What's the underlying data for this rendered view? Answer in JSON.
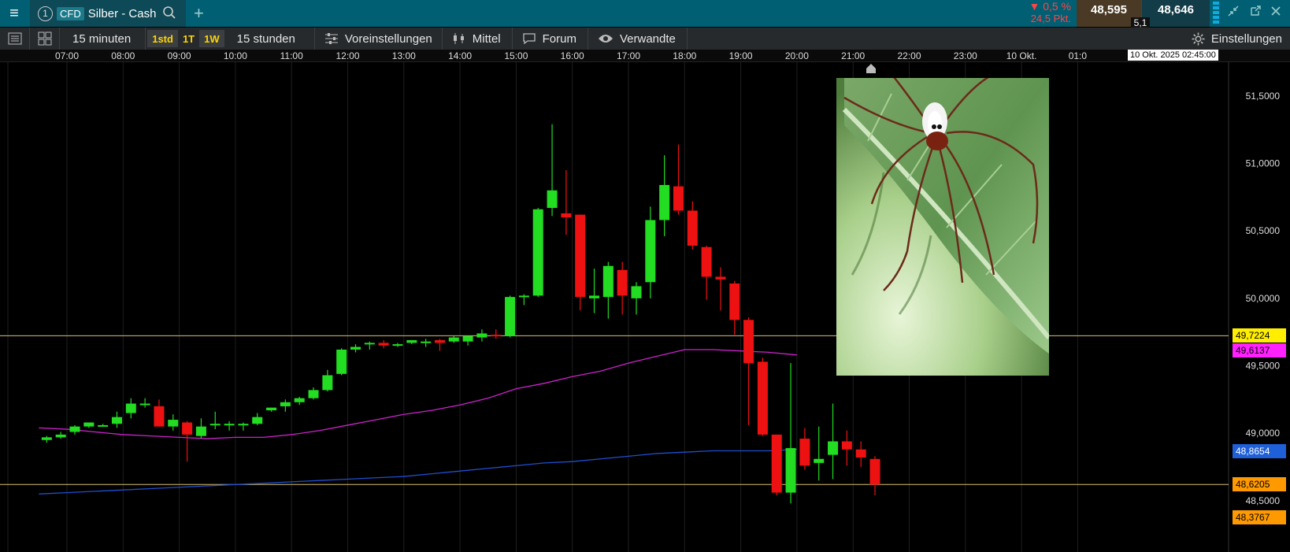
{
  "topbar": {
    "menu_icon": "menu-icon",
    "tab": {
      "number": "1",
      "badge": "CFD",
      "title": "Silber - Cash"
    },
    "change_pct": "▼ 0,5 %",
    "change_pts": "24,5 Pkt.",
    "bid": "48,595",
    "ask": "48,646",
    "spread": "5,1"
  },
  "toolbar": {
    "interval": "15 minuten",
    "period_1std": "1std",
    "period_1t": "1T",
    "period_1w": "1W",
    "range": "15 stunden",
    "presets": "Voreinstellungen",
    "indicator": "Mittel",
    "forum": "Forum",
    "related": "Verwandte",
    "settings": "Einstellungen"
  },
  "timeaxis": {
    "labels": [
      "07:00",
      "08:00",
      "09:00",
      "10:00",
      "11:00",
      "12:00",
      "13:00",
      "14:00",
      "15:00",
      "16:00",
      "17:00",
      "18:00",
      "19:00",
      "20:00",
      "21:00",
      "22:00",
      "23:00",
      "10 Okt.",
      "01:0"
    ],
    "current": "10 Okt. 2025 02:45:00"
  },
  "chart_data": {
    "type": "candlestick",
    "instrument": "Silber - Cash",
    "interval": "15 minuten",
    "ylim": [
      48.12,
      51.75
    ],
    "y_ticks": [
      "51,5000",
      "51,0000",
      "50,5000",
      "50,0000",
      "49,5000",
      "49,0000",
      "48,5000"
    ],
    "colors": {
      "up": "#22dd22",
      "down": "#ee1111",
      "ma_magenta": "#cc22cc",
      "ma_blue": "#1f4fd0",
      "hline": "#d9c070"
    },
    "x_start_hour": 6.5,
    "x_step_hours": 0.25,
    "candles": [
      {
        "o": 48.95,
        "h": 48.98,
        "l": 48.93,
        "c": 48.97
      },
      {
        "o": 48.97,
        "h": 49.01,
        "l": 48.96,
        "c": 48.99
      },
      {
        "o": 49.01,
        "h": 49.06,
        "l": 48.99,
        "c": 49.05
      },
      {
        "o": 49.05,
        "h": 49.08,
        "l": 49.04,
        "c": 49.08
      },
      {
        "o": 49.06,
        "h": 49.07,
        "l": 49.05,
        "c": 49.06
      },
      {
        "o": 49.07,
        "h": 49.16,
        "l": 49.04,
        "c": 49.12
      },
      {
        "o": 49.15,
        "h": 49.26,
        "l": 49.11,
        "c": 49.22
      },
      {
        "o": 49.22,
        "h": 49.26,
        "l": 49.19,
        "c": 49.22
      },
      {
        "o": 49.2,
        "h": 49.25,
        "l": 49.05,
        "c": 49.05
      },
      {
        "o": 49.05,
        "h": 49.14,
        "l": 49.02,
        "c": 49.1
      },
      {
        "o": 49.08,
        "h": 49.09,
        "l": 48.79,
        "c": 48.99
      },
      {
        "o": 48.98,
        "h": 49.11,
        "l": 48.96,
        "c": 49.05
      },
      {
        "o": 49.06,
        "h": 49.16,
        "l": 49.03,
        "c": 49.07
      },
      {
        "o": 49.06,
        "h": 49.09,
        "l": 49.02,
        "c": 49.07
      },
      {
        "o": 49.06,
        "h": 49.08,
        "l": 49.02,
        "c": 49.07
      },
      {
        "o": 49.07,
        "h": 49.15,
        "l": 49.06,
        "c": 49.12
      },
      {
        "o": 49.17,
        "h": 49.19,
        "l": 49.16,
        "c": 49.19
      },
      {
        "o": 49.2,
        "h": 49.25,
        "l": 49.16,
        "c": 49.23
      },
      {
        "o": 49.23,
        "h": 49.27,
        "l": 49.21,
        "c": 49.26
      },
      {
        "o": 49.26,
        "h": 49.34,
        "l": 49.25,
        "c": 49.32
      },
      {
        "o": 49.32,
        "h": 49.47,
        "l": 49.31,
        "c": 49.43
      },
      {
        "o": 49.44,
        "h": 49.63,
        "l": 49.43,
        "c": 49.62
      },
      {
        "o": 49.62,
        "h": 49.66,
        "l": 49.6,
        "c": 49.64
      },
      {
        "o": 49.66,
        "h": 49.68,
        "l": 49.62,
        "c": 49.67
      },
      {
        "o": 49.67,
        "h": 49.69,
        "l": 49.63,
        "c": 49.65
      },
      {
        "o": 49.66,
        "h": 49.67,
        "l": 49.64,
        "c": 49.66
      },
      {
        "o": 49.67,
        "h": 49.69,
        "l": 49.66,
        "c": 49.69
      },
      {
        "o": 49.68,
        "h": 49.7,
        "l": 49.64,
        "c": 49.68
      },
      {
        "o": 49.69,
        "h": 49.7,
        "l": 49.61,
        "c": 49.67
      },
      {
        "o": 49.68,
        "h": 49.72,
        "l": 49.67,
        "c": 49.71
      },
      {
        "o": 49.68,
        "h": 49.72,
        "l": 49.65,
        "c": 49.72
      },
      {
        "o": 49.71,
        "h": 49.77,
        "l": 49.68,
        "c": 49.74
      },
      {
        "o": 49.73,
        "h": 49.77,
        "l": 49.7,
        "c": 49.72
      },
      {
        "o": 49.72,
        "h": 50.02,
        "l": 49.71,
        "c": 50.01
      },
      {
        "o": 50.01,
        "h": 50.03,
        "l": 49.95,
        "c": 50.02
      },
      {
        "o": 50.02,
        "h": 50.67,
        "l": 50.01,
        "c": 50.66
      },
      {
        "o": 50.67,
        "h": 51.29,
        "l": 50.61,
        "c": 50.8
      },
      {
        "o": 50.63,
        "h": 50.95,
        "l": 50.47,
        "c": 50.6
      },
      {
        "o": 50.62,
        "h": 50.62,
        "l": 49.91,
        "c": 50.01
      },
      {
        "o": 50.0,
        "h": 50.22,
        "l": 49.89,
        "c": 50.02
      },
      {
        "o": 50.01,
        "h": 50.27,
        "l": 49.85,
        "c": 50.24
      },
      {
        "o": 50.21,
        "h": 50.27,
        "l": 49.88,
        "c": 50.02
      },
      {
        "o": 50.0,
        "h": 50.12,
        "l": 49.88,
        "c": 50.09
      },
      {
        "o": 50.12,
        "h": 50.68,
        "l": 50.0,
        "c": 50.58
      },
      {
        "o": 50.58,
        "h": 51.06,
        "l": 50.46,
        "c": 50.84
      },
      {
        "o": 50.83,
        "h": 51.14,
        "l": 50.62,
        "c": 50.65
      },
      {
        "o": 50.65,
        "h": 50.72,
        "l": 50.36,
        "c": 50.39
      },
      {
        "o": 50.38,
        "h": 50.39,
        "l": 49.99,
        "c": 50.16
      },
      {
        "o": 50.16,
        "h": 50.23,
        "l": 49.91,
        "c": 50.14
      },
      {
        "o": 50.11,
        "h": 50.13,
        "l": 49.73,
        "c": 49.84
      },
      {
        "o": 49.84,
        "h": 49.86,
        "l": 49.06,
        "c": 49.52
      },
      {
        "o": 49.53,
        "h": 49.56,
        "l": 48.98,
        "c": 48.99
      },
      {
        "o": 48.99,
        "h": 48.99,
        "l": 48.54,
        "c": 48.56
      },
      {
        "o": 48.56,
        "h": 49.52,
        "l": 48.48,
        "c": 48.89
      },
      {
        "o": 48.96,
        "h": 49.04,
        "l": 48.73,
        "c": 48.76
      },
      {
        "o": 48.78,
        "h": 49.05,
        "l": 48.65,
        "c": 48.81
      },
      {
        "o": 48.84,
        "h": 49.22,
        "l": 48.66,
        "c": 48.94
      },
      {
        "o": 48.94,
        "h": 49.02,
        "l": 48.76,
        "c": 48.88
      },
      {
        "o": 48.88,
        "h": 48.94,
        "l": 48.75,
        "c": 48.82
      },
      {
        "o": 48.81,
        "h": 48.83,
        "l": 48.54,
        "c": 48.62
      }
    ],
    "ma_magenta": [
      49.04,
      49.03,
      49.01,
      48.99,
      48.98,
      48.97,
      48.96,
      48.97,
      48.97,
      48.99,
      49.02,
      49.06,
      49.1,
      49.14,
      49.17,
      49.21,
      49.26,
      49.33,
      49.37,
      49.42,
      49.46,
      49.52,
      49.57,
      49.62,
      49.62,
      49.61,
      49.6,
      49.58
    ],
    "ma_magenta_x_start_hour": 6.5,
    "ma_magenta_step_hours": 0.5,
    "ma_blue": [
      48.55,
      48.56,
      48.57,
      48.58,
      48.59,
      48.6,
      48.61,
      48.62,
      48.63,
      48.64,
      48.65,
      48.66,
      48.67,
      48.68,
      48.7,
      48.72,
      48.74,
      48.76,
      48.78,
      48.79,
      48.81,
      48.83,
      48.85,
      48.86,
      48.87,
      48.87,
      48.87,
      48.88
    ],
    "ma_blue_x_start_hour": 6.5,
    "ma_blue_step_hours": 0.5,
    "hlines": [
      49.7224,
      48.6205
    ],
    "price_tags": [
      {
        "label": "49,7224",
        "value": 49.7224,
        "bg": "#ffee00",
        "fg": "#000"
      },
      {
        "label": "49,6137",
        "value": 49.6137,
        "bg": "#ff22ff",
        "fg": "#000"
      },
      {
        "label": "48,8654",
        "value": 48.8654,
        "bg": "#1f5fd8",
        "fg": "#fff"
      },
      {
        "label": "48,6205",
        "value": 48.6205,
        "bg": "#ff9900",
        "fg": "#000"
      },
      {
        "label": "48,3767",
        "value": 48.3767,
        "bg": "#ff9900",
        "fg": "#000"
      }
    ]
  },
  "overlay": {
    "image_icon": "spider-photo"
  }
}
